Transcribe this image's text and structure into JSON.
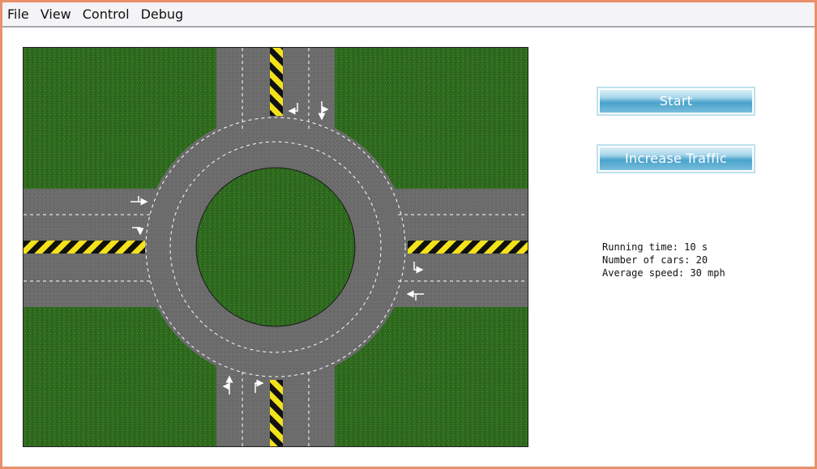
{
  "menu": {
    "items": [
      {
        "label": "File"
      },
      {
        "label": "View"
      },
      {
        "label": "Control"
      },
      {
        "label": "Debug"
      }
    ]
  },
  "controls": {
    "start_label": "Start",
    "increase_traffic_label": "Increase Traffic"
  },
  "stats": {
    "running_time": "Running time: 10 s",
    "number_of_cars": "Number of cars: 20",
    "average_speed": "Average speed: 30 mph"
  },
  "colors": {
    "grass": "#2f6a1f",
    "road": "#6b6b6b",
    "hazard_yellow": "#f2e21a",
    "hazard_black": "#111111",
    "window_border": "#e8906a"
  }
}
